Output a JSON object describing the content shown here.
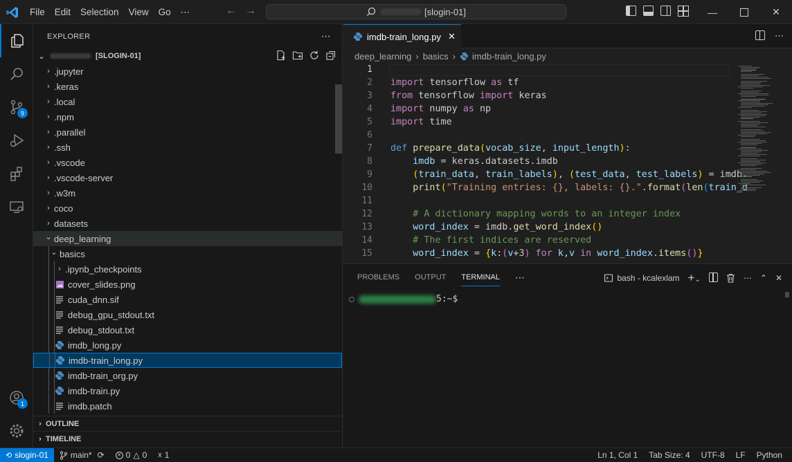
{
  "titlebar": {
    "menus": [
      "File",
      "Edit",
      "Selection",
      "View",
      "Go",
      "⋯"
    ],
    "command_center": "[slogin-01]"
  },
  "activity": {
    "scm_badge": "9",
    "accounts_badge": "1"
  },
  "sidebar": {
    "title": "EXPLORER",
    "more": "⋯",
    "workspace": "[SLOGIN-01]",
    "tree": [
      {
        "label": ".jupyter",
        "type": "folder",
        "depth": 0
      },
      {
        "label": ".keras",
        "type": "folder",
        "depth": 0
      },
      {
        "label": ".local",
        "type": "folder",
        "depth": 0
      },
      {
        "label": ".npm",
        "type": "folder",
        "depth": 0
      },
      {
        "label": ".parallel",
        "type": "folder",
        "depth": 0
      },
      {
        "label": ".ssh",
        "type": "folder",
        "depth": 0
      },
      {
        "label": ".vscode",
        "type": "folder",
        "depth": 0
      },
      {
        "label": ".vscode-server",
        "type": "folder",
        "depth": 0
      },
      {
        "label": ".w3m",
        "type": "folder",
        "depth": 0
      },
      {
        "label": "coco",
        "type": "folder",
        "depth": 0
      },
      {
        "label": "datasets",
        "type": "folder",
        "depth": 0
      },
      {
        "label": "deep_learning",
        "type": "folder-open",
        "depth": 0
      },
      {
        "label": "basics",
        "type": "folder-open",
        "depth": 1
      },
      {
        "label": ".ipynb_checkpoints",
        "type": "folder",
        "depth": 2
      },
      {
        "label": "cover_slides.png",
        "type": "image",
        "depth": 2
      },
      {
        "label": "cuda_dnn.sif",
        "type": "text",
        "depth": 2
      },
      {
        "label": "debug_gpu_stdout.txt",
        "type": "text",
        "depth": 2
      },
      {
        "label": "debug_stdout.txt",
        "type": "text",
        "depth": 2
      },
      {
        "label": "imdb_long.py",
        "type": "python",
        "depth": 2
      },
      {
        "label": "imdb-train_long.py",
        "type": "python",
        "depth": 2,
        "selected": true
      },
      {
        "label": "imdb-train_org.py",
        "type": "python",
        "depth": 2
      },
      {
        "label": "imdb-train.py",
        "type": "python",
        "depth": 2
      },
      {
        "label": "imdb.patch",
        "type": "text",
        "depth": 2
      }
    ],
    "outline": "OUTLINE",
    "timeline": "TIMELINE"
  },
  "editor": {
    "tab_label": "imdb-train_long.py",
    "breadcrumb": [
      "deep_learning",
      "basics",
      "imdb-train_long.py"
    ],
    "lines": [
      {
        "n": "1",
        "tokens": []
      },
      {
        "n": "2",
        "tokens": [
          [
            "kw",
            "import"
          ],
          [
            "pl",
            " tensorflow "
          ],
          [
            "kw",
            "as"
          ],
          [
            "pl",
            " tf"
          ]
        ]
      },
      {
        "n": "3",
        "tokens": [
          [
            "kw",
            "from"
          ],
          [
            "pl",
            " tensorflow "
          ],
          [
            "kw",
            "import"
          ],
          [
            "pl",
            " keras"
          ]
        ]
      },
      {
        "n": "4",
        "tokens": [
          [
            "kw",
            "import"
          ],
          [
            "pl",
            " numpy "
          ],
          [
            "kw",
            "as"
          ],
          [
            "pl",
            " np"
          ]
        ]
      },
      {
        "n": "5",
        "tokens": [
          [
            "kw",
            "import"
          ],
          [
            "pl",
            " time"
          ]
        ]
      },
      {
        "n": "6",
        "tokens": []
      },
      {
        "n": "7",
        "tokens": [
          [
            "kd",
            "def"
          ],
          [
            "pl",
            " "
          ],
          [
            "fn",
            "prepare_data"
          ],
          [
            "br1",
            "("
          ],
          [
            "va",
            "vocab_size"
          ],
          [
            "pl",
            ", "
          ],
          [
            "va",
            "input_length"
          ],
          [
            "br1",
            ")"
          ],
          [
            "pl",
            ":"
          ]
        ]
      },
      {
        "n": "8",
        "tokens": [
          [
            "pl",
            "    "
          ],
          [
            "va",
            "imdb"
          ],
          [
            "pl",
            " = keras.datasets.imdb"
          ]
        ]
      },
      {
        "n": "9",
        "tokens": [
          [
            "pl",
            "    "
          ],
          [
            "br1",
            "("
          ],
          [
            "va",
            "train_data"
          ],
          [
            "pl",
            ", "
          ],
          [
            "va",
            "train_labels"
          ],
          [
            "br1",
            ")"
          ],
          [
            "pl",
            ", "
          ],
          [
            "br1",
            "("
          ],
          [
            "va",
            "test_data"
          ],
          [
            "pl",
            ", "
          ],
          [
            "va",
            "test_labels"
          ],
          [
            "br1",
            ")"
          ],
          [
            "pl",
            " = imdb."
          ]
        ]
      },
      {
        "n": "10",
        "tokens": [
          [
            "pl",
            "    "
          ],
          [
            "fn",
            "print"
          ],
          [
            "br1",
            "("
          ],
          [
            "st",
            "\"Training entries: {}, labels: {}.\""
          ],
          [
            "pl",
            "."
          ],
          [
            "fn",
            "format"
          ],
          [
            "br2",
            "("
          ],
          [
            "fn",
            "len"
          ],
          [
            "br3",
            "("
          ],
          [
            "va",
            "train_d"
          ]
        ]
      },
      {
        "n": "11",
        "tokens": []
      },
      {
        "n": "12",
        "tokens": [
          [
            "pl",
            "    "
          ],
          [
            "cm",
            "# A dictionary mapping words to an integer index"
          ]
        ]
      },
      {
        "n": "13",
        "tokens": [
          [
            "pl",
            "    "
          ],
          [
            "va",
            "word_index"
          ],
          [
            "pl",
            " = imdb."
          ],
          [
            "fn",
            "get_word_index"
          ],
          [
            "br1",
            "()"
          ]
        ]
      },
      {
        "n": "14",
        "tokens": [
          [
            "pl",
            "    "
          ],
          [
            "cm",
            "# The first indices are reserved"
          ]
        ]
      },
      {
        "n": "15",
        "tokens": [
          [
            "pl",
            "    "
          ],
          [
            "va",
            "word_index"
          ],
          [
            "pl",
            " = "
          ],
          [
            "br1",
            "{"
          ],
          [
            "va",
            "k"
          ],
          [
            "pl",
            ":"
          ],
          [
            "br2",
            "("
          ],
          [
            "va",
            "v"
          ],
          [
            "pl",
            "+"
          ],
          [
            "nu",
            "3"
          ],
          [
            "br2",
            ")"
          ],
          [
            "pl",
            " "
          ],
          [
            "kw",
            "for"
          ],
          [
            "pl",
            " "
          ],
          [
            "va",
            "k"
          ],
          [
            "pl",
            ","
          ],
          [
            "va",
            "v"
          ],
          [
            "pl",
            " "
          ],
          [
            "kw",
            "in"
          ],
          [
            "pl",
            " "
          ],
          [
            "va",
            "word_index"
          ],
          [
            "pl",
            "."
          ],
          [
            "fn",
            "items"
          ],
          [
            "br2",
            "()"
          ],
          [
            "br1",
            "}"
          ]
        ]
      }
    ]
  },
  "panel": {
    "tabs": [
      "PROBLEMS",
      "OUTPUT",
      "TERMINAL"
    ],
    "more": "⋯",
    "terminal_name": "bash - kcalexlam",
    "prompt_suffix": "5:~$"
  },
  "statusbar": {
    "remote": "slogin-01",
    "branch": "main*",
    "errors": "0",
    "warnings": "0",
    "ports": "1",
    "position": "Ln 1, Col 1",
    "tab_size": "Tab Size: 4",
    "encoding": "UTF-8",
    "eol": "LF",
    "language": "Python"
  },
  "colors": {
    "accent": "#0078d4",
    "background": "#1f1f1f",
    "sidebar": "#181818"
  }
}
